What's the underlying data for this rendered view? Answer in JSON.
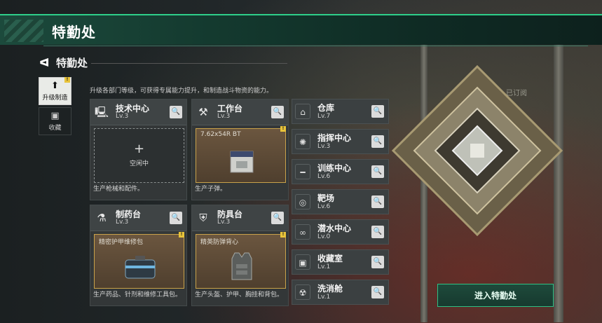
{
  "header": {
    "title": "特勤处"
  },
  "subheader": {
    "back_symbol": "ᐊ",
    "title": "特勤处"
  },
  "description": "升级各部门等级，可获得专属能力提升，和制造战斗物资的能力。",
  "tabs": [
    {
      "label": "升级制造",
      "icon": "upgrade-icon",
      "active": true
    },
    {
      "label": "收藏",
      "icon": "collection-icon",
      "active": false
    }
  ],
  "cards": [
    {
      "name": "技术中心",
      "level": "Lv.3",
      "icon": "computer-icon",
      "slot_state": "empty",
      "plus": "+",
      "slot_text": "空闲中",
      "footer": "生产枪械和配件。"
    },
    {
      "name": "工作台",
      "level": "Lv.3",
      "icon": "tools-icon",
      "slot_state": "full",
      "slot_text": "7.62x54R BT",
      "footer": "生产子弹。"
    },
    {
      "name": "制药台",
      "level": "Lv.3",
      "icon": "microscope-icon",
      "slot_state": "full",
      "slot_text": "精密护甲维修包",
      "footer": "生产药品、针剂和维修工具包。"
    },
    {
      "name": "防具台",
      "level": "Lv.3",
      "icon": "armor-icon",
      "slot_state": "full",
      "slot_text": "精英防弹背心",
      "footer": "生产头盔、护甲、胸挂和背包。"
    }
  ],
  "facilities": [
    {
      "name": "仓库",
      "level": "Lv.7",
      "icon": "warehouse-icon"
    },
    {
      "name": "指挥中心",
      "level": "Lv.3",
      "icon": "command-icon"
    },
    {
      "name": "训练中心",
      "level": "Lv.6",
      "icon": "dumbbell-icon"
    },
    {
      "name": "靶场",
      "level": "Lv.6",
      "icon": "target-icon"
    },
    {
      "name": "潜水中心",
      "level": "Lv.0",
      "icon": "diving-icon"
    },
    {
      "name": "收藏室",
      "level": "Lv.1",
      "icon": "collection-room-icon"
    },
    {
      "name": "洗消舱",
      "level": "Lv.1",
      "icon": "decon-icon"
    }
  ],
  "subscribed_label": "已订阅",
  "enter_button": "进入特勤处",
  "badge_symbol": "!",
  "search_symbol": "🔍",
  "colors": {
    "accent": "#2ecf8a",
    "badge": "#e8c33a",
    "slot_border": "#c9a24a"
  }
}
